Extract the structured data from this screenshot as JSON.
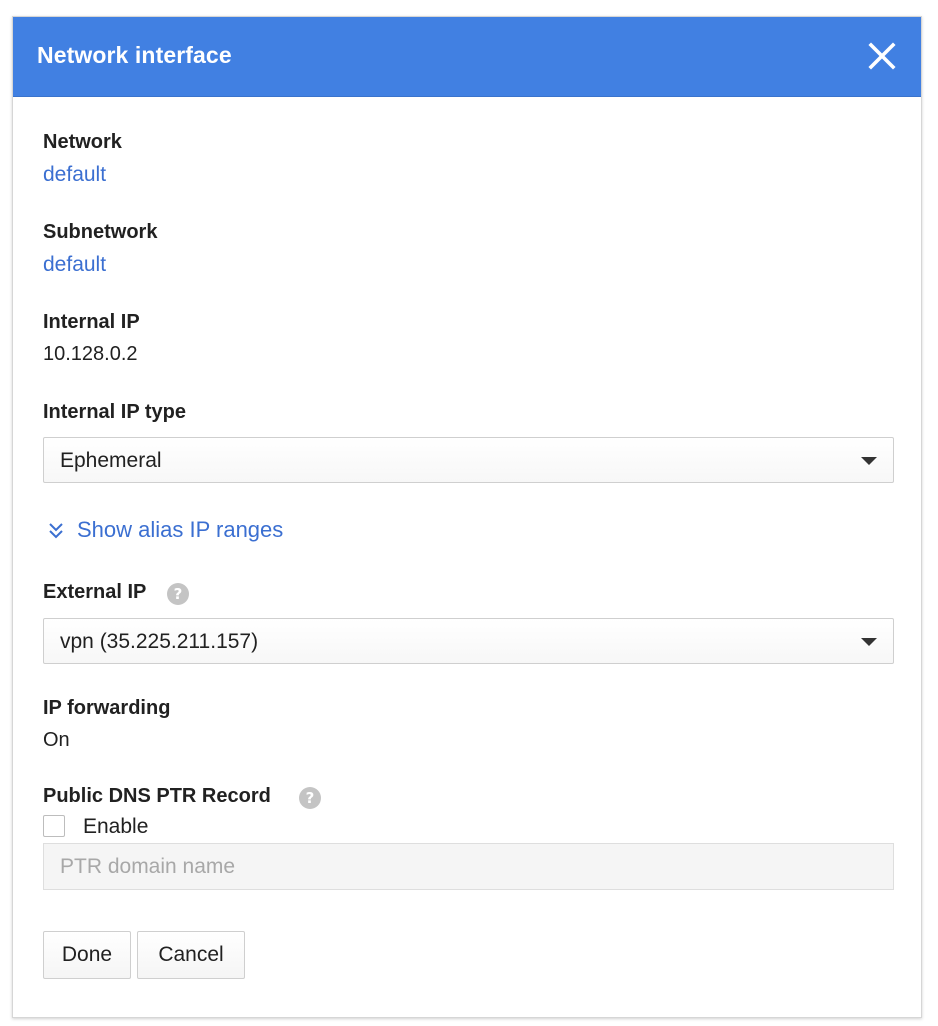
{
  "dialog": {
    "title": "Network interface",
    "close_icon": "close-icon"
  },
  "network": {
    "label": "Network",
    "value": "default"
  },
  "subnetwork": {
    "label": "Subnetwork",
    "value": "default"
  },
  "internal_ip": {
    "label": "Internal IP",
    "value": "10.128.0.2"
  },
  "internal_ip_type": {
    "label": "Internal IP type",
    "selected": "Ephemeral"
  },
  "alias": {
    "label": "Show alias IP ranges",
    "icon": "double-chevron-down-icon"
  },
  "external_ip": {
    "label": "External IP",
    "help_icon": "help-icon",
    "selected": "vpn (35.225.211.157)"
  },
  "ip_forwarding": {
    "label": "IP forwarding",
    "value": "On"
  },
  "ptr_record": {
    "label": "Public DNS PTR Record",
    "help_icon": "help-icon",
    "checkbox_label": "Enable",
    "checked": false,
    "placeholder": "PTR domain name"
  },
  "actions": {
    "done_label": "Done",
    "cancel_label": "Cancel"
  },
  "colors": {
    "header_bg": "#4180e2",
    "link": "#3b6fd1",
    "help_icon": "#c4c4c4"
  }
}
